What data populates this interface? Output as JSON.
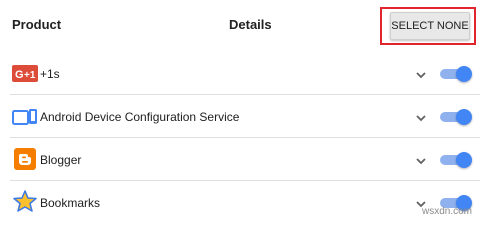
{
  "header": {
    "product": "Product",
    "details": "Details",
    "select_none": "SELECT NONE"
  },
  "products": [
    {
      "label": "+1s",
      "icon": "google-plus-icon",
      "enabled": true
    },
    {
      "label": "Android Device Configuration Service",
      "icon": "android-device-icon",
      "enabled": true
    },
    {
      "label": "Blogger",
      "icon": "blogger-icon",
      "enabled": true
    },
    {
      "label": "Bookmarks",
      "icon": "bookmarks-star-icon",
      "enabled": true
    }
  ],
  "watermark": "wsxdn.com",
  "colors": {
    "toggle_on": "#4285f4",
    "highlight": "#e0252c"
  }
}
